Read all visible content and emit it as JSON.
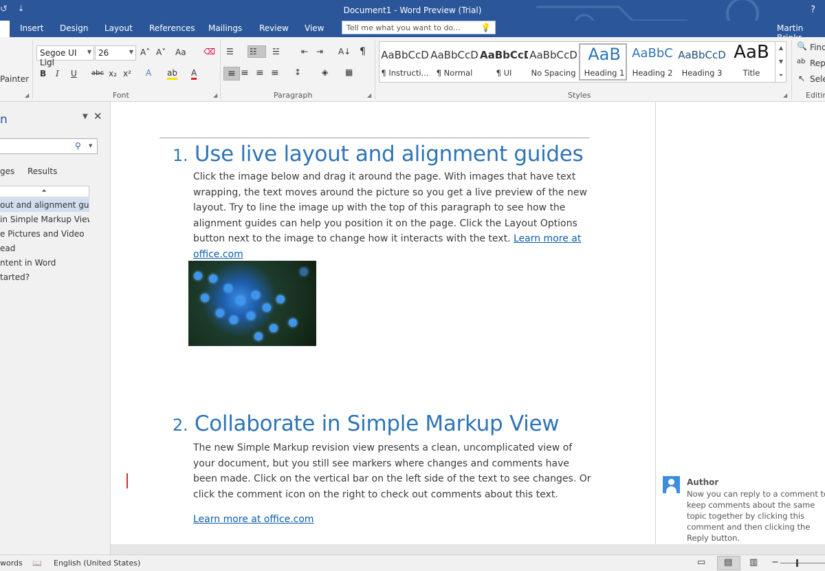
{
  "window": {
    "title": "Document1 - Word Preview (Trial)",
    "help_glyph": "?",
    "user": "Martin Brinkr"
  },
  "quick_access": {
    "undo_glyph": "↺",
    "customize_glyph": "⇣"
  },
  "tabs": [
    {
      "label": "Insert"
    },
    {
      "label": "Design"
    },
    {
      "label": "Layout"
    },
    {
      "label": "References"
    },
    {
      "label": "Mailings"
    },
    {
      "label": "Review"
    },
    {
      "label": "View"
    }
  ],
  "tell_me": {
    "placeholder": "Tell me what you want to do..."
  },
  "ribbon": {
    "clipboard": {
      "painter_label": "Painter"
    },
    "font": {
      "label": "Font",
      "font_name": "Segoe UI Ligl",
      "font_size": "26",
      "grow": "A˄",
      "shrink": "A˅",
      "case": "Aa",
      "clear": "⌫",
      "bold": "B",
      "italic": "I",
      "underline": "U",
      "strikethrough": "abc",
      "subscript": "x₂",
      "superscript": "x²",
      "effects": "A",
      "highlight": "ab",
      "font_color": "A"
    },
    "paragraph": {
      "label": "Paragraph",
      "bullets": "☰",
      "numbering": "☷",
      "multilevel": "☱",
      "decrease_indent": "⇤",
      "increase_indent": "⇥",
      "sort": "A↓",
      "show_marks": "¶",
      "align_left": "≡",
      "align_center": "≡",
      "align_right": "≡",
      "justify": "≡",
      "line_spacing": "↕",
      "shading": "◈",
      "borders": "▦"
    },
    "styles": {
      "label": "Styles",
      "items": [
        {
          "sample": "AaBbCcD",
          "name": "¶ Instructi..."
        },
        {
          "sample": "AaBbCcD",
          "name": "¶ Normal"
        },
        {
          "sample": "AaBbCcD",
          "name": "¶ UI"
        },
        {
          "sample": "AaBbCcD",
          "name": "No Spacing"
        },
        {
          "sample": "AaB",
          "name": "Heading 1"
        },
        {
          "sample": "AaBbC",
          "name": "Heading 2"
        },
        {
          "sample": "AaBbCcD",
          "name": "Heading 3"
        },
        {
          "sample": "AaB",
          "name": "Title"
        }
      ],
      "selected": "Heading 1"
    },
    "editing": {
      "label": "Editin",
      "find": "Find",
      "replace": "Repl",
      "select": "Sele"
    }
  },
  "nav_pane": {
    "title": "n",
    "search_placeholder": "",
    "tabs": [
      "ges",
      "Results"
    ],
    "collapse_glyph": "⏶",
    "items": [
      "out and alignment gui...",
      "in Simple Markup View",
      "e Pictures and Video",
      "ead",
      "ntent in Word",
      "tarted?"
    ],
    "active_index": 0
  },
  "document": {
    "section1": {
      "number": "1.",
      "heading": "Use live layout and alignment guides",
      "body": "Click the image below and drag it around the page. With images that have text wrapping, the text moves around the picture so you get a live preview of the new layout. Try to line the image up with the top of this paragraph to see how the alignment guides can help you position it on the page.  Click the Layout Options button next to the image to change how it interacts with the text. ",
      "link": "Learn more at office.com"
    },
    "section2": {
      "number": "2.",
      "heading": "Collaborate in Simple Markup View",
      "body": "The new Simple Markup revision view presents a clean, uncomplicated view of your document, but you still see markers where changes and comments have been made. Click on the vertical bar on the left side of the text to see changes. Or click the comment icon on the right to check out comments about this text.",
      "link": "Learn more at office.com"
    }
  },
  "comment": {
    "author": "Author",
    "text": "Now you can reply to a comment to keep comments about the same topic together by clicking this comment and then clicking the Reply button."
  },
  "status_bar": {
    "words": "words",
    "language": "English (United States)",
    "zoom_minus": "−",
    "zoom_plus": "+"
  },
  "colors": {
    "title_bar": "#2b579a",
    "heading": "#2e74b5",
    "link": "#0b5cad",
    "change_bar": "#d32f2f",
    "comment_avatar": "#3e8ede"
  }
}
